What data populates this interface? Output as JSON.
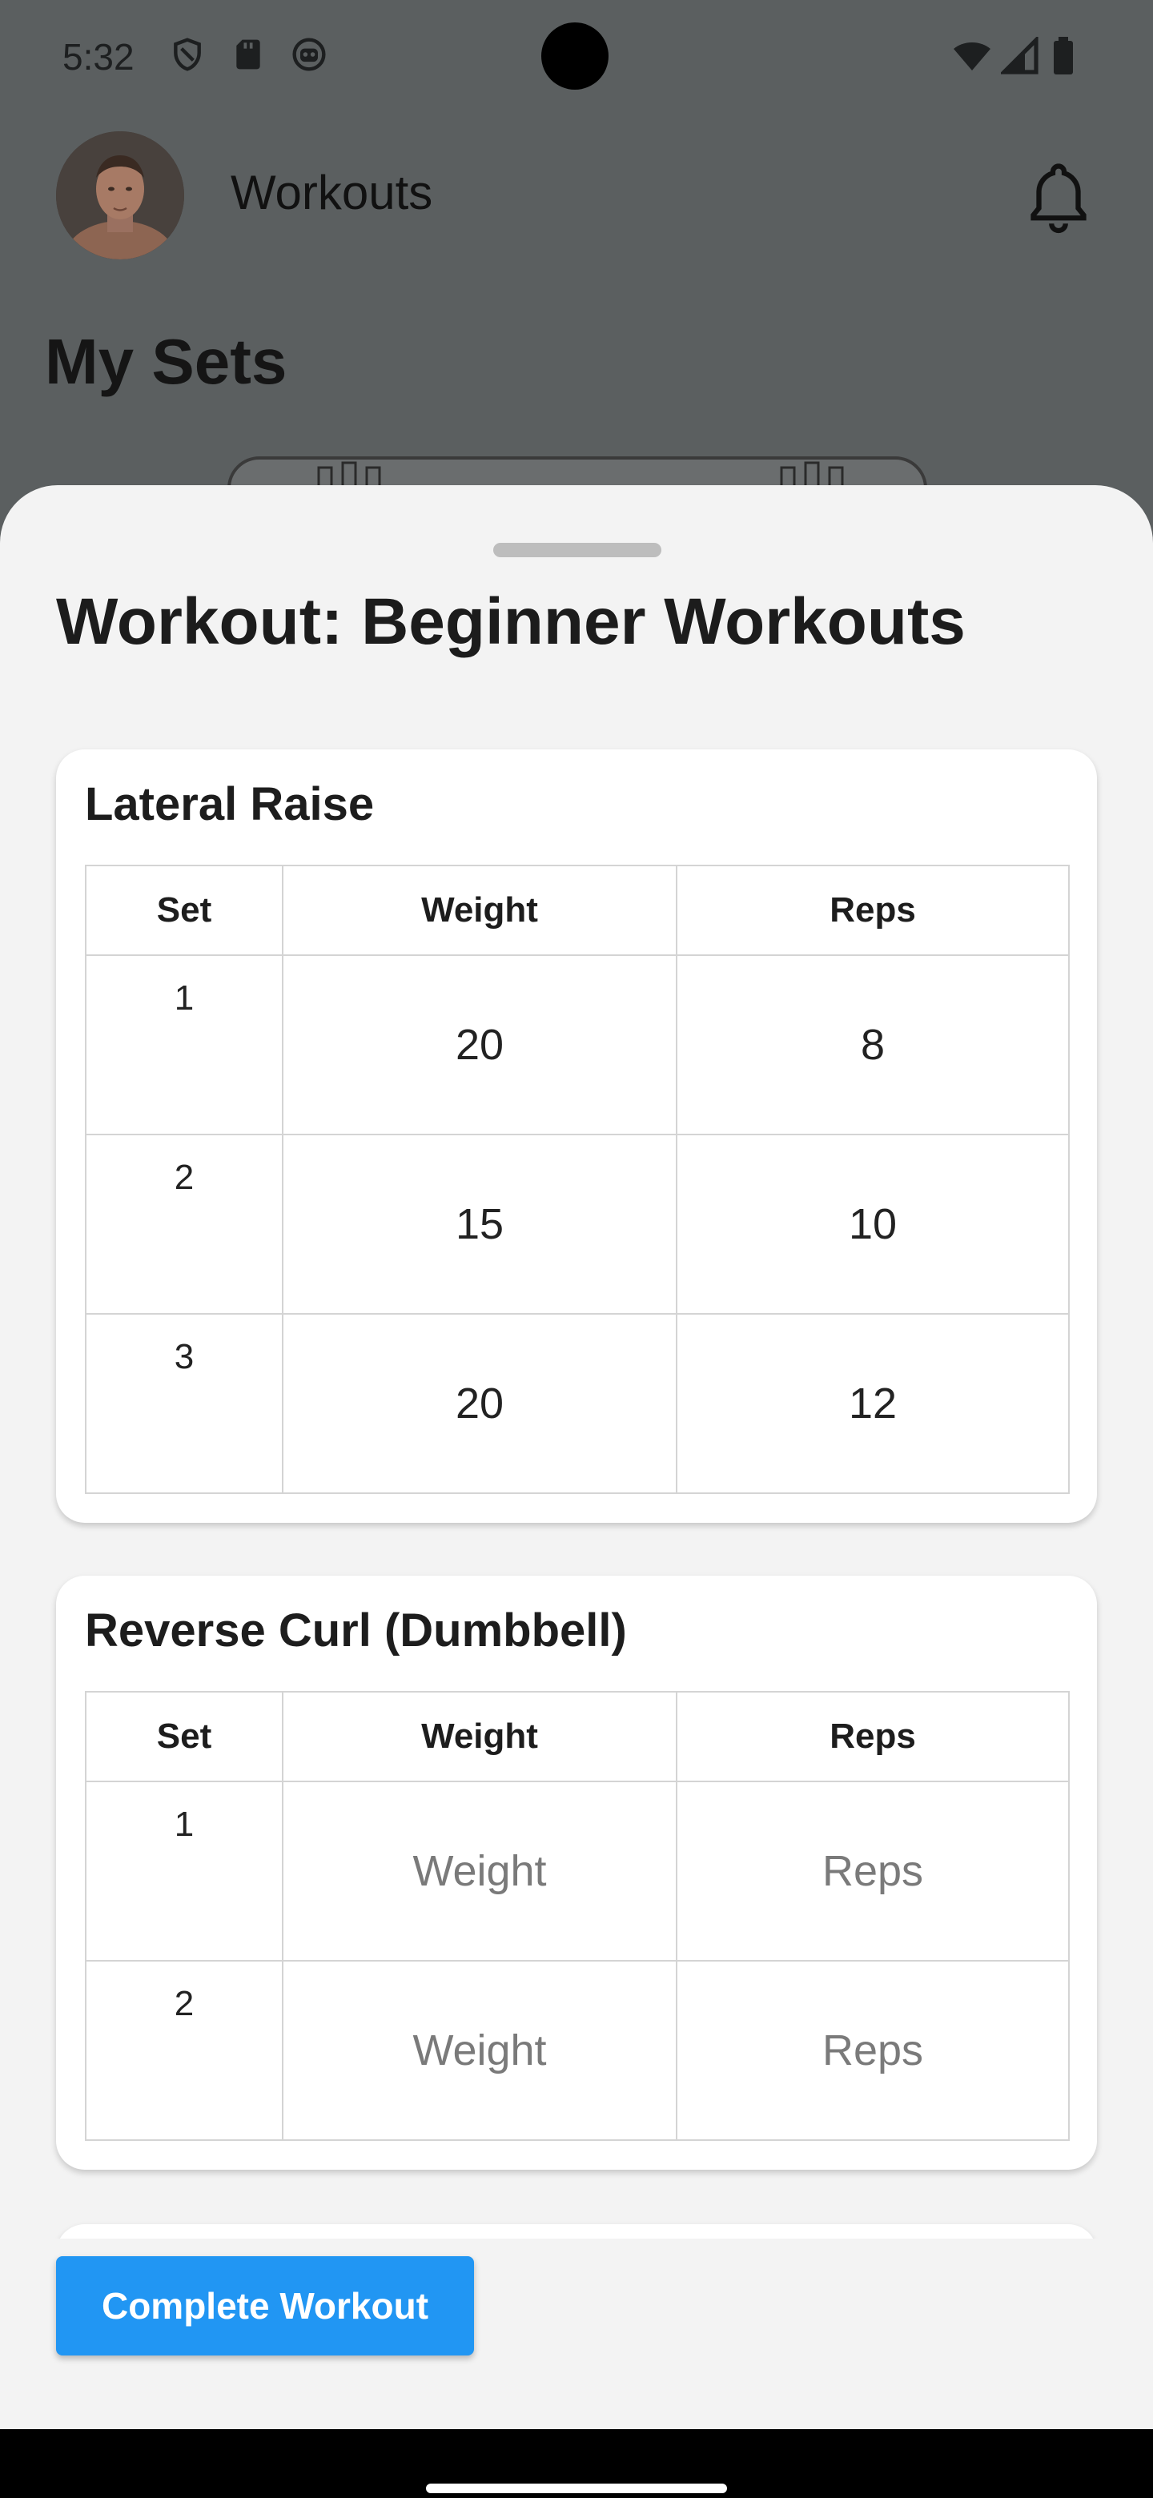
{
  "status_bar": {
    "time": "5:32",
    "icons_left": [
      "shield-icon",
      "sd-card-icon",
      "robot-icon"
    ],
    "icons_right": [
      "wifi-icon",
      "signal-icon",
      "battery-icon"
    ]
  },
  "header": {
    "title": "Workouts",
    "avatar": "profile-avatar",
    "notification_icon": "bell-icon"
  },
  "page": {
    "heading": "My Sets"
  },
  "sheet": {
    "title": "Workout: Beginner Workouts",
    "columns": {
      "set": "Set",
      "weight": "Weight",
      "reps": "Reps"
    },
    "exercises": [
      {
        "name": "Lateral Raise",
        "sets": [
          {
            "set": "1",
            "weight": "20",
            "reps": "8"
          },
          {
            "set": "2",
            "weight": "15",
            "reps": "10"
          },
          {
            "set": "3",
            "weight": "20",
            "reps": "12"
          }
        ]
      },
      {
        "name": "Reverse Curl (Dumbbell)",
        "sets": [
          {
            "set": "1",
            "weight_placeholder": "Weight",
            "reps_placeholder": "Reps"
          },
          {
            "set": "2",
            "weight_placeholder": "Weight",
            "reps_placeholder": "Reps"
          }
        ]
      }
    ],
    "complete_button": "Complete Workout"
  },
  "colors": {
    "accent": "#2196f3",
    "scrim": "#5b5f60",
    "sheet_bg": "#f3f3f3",
    "card_bg": "#ffffff",
    "placeholder_text": "#7a7a7a"
  }
}
